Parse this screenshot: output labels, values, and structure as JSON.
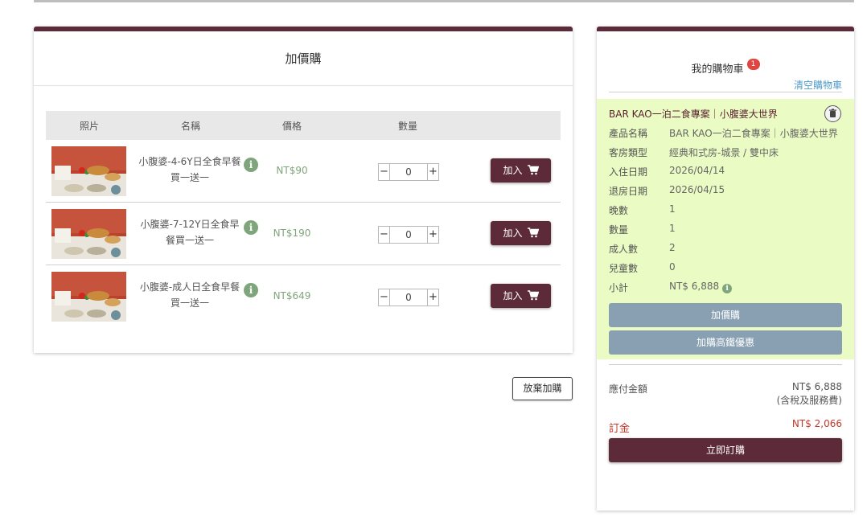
{
  "addon": {
    "title": "加價購",
    "columns": [
      "照片",
      "名稱",
      "價格",
      "數量"
    ],
    "items": [
      {
        "name": "小腹婆-4-6Y日全食早餐買一送一",
        "price": "NT$90",
        "qty": "0",
        "button": "加入"
      },
      {
        "name": "小腹婆-7-12Y日全食早餐買一送一",
        "price": "NT$190",
        "qty": "0",
        "button": "加入"
      },
      {
        "name": "小腹婆-成人日全食早餐買一送一",
        "price": "NT$649",
        "qty": "0",
        "button": "加入"
      }
    ],
    "minus": "−",
    "plus": "+",
    "giveup_label": "放棄加購"
  },
  "cart": {
    "title": "我的購物車",
    "badge": "1",
    "clear_label": "清空購物車",
    "item": {
      "title": "BAR KAO一泊二食專案｜小腹婆大世界",
      "rows": [
        {
          "k": "產品名稱",
          "v": "BAR KAO一泊二食專案｜小腹婆大世界"
        },
        {
          "k": "客房類型",
          "v": "經典和式房-城景 / 雙中床"
        },
        {
          "k": "入住日期",
          "v": "2026/04/14"
        },
        {
          "k": "退房日期",
          "v": "2026/04/15"
        },
        {
          "k": "晚數",
          "v": "1"
        },
        {
          "k": "數量",
          "v": "1"
        },
        {
          "k": "成人數",
          "v": "2"
        },
        {
          "k": "兒童數",
          "v": "0"
        },
        {
          "k": "小計",
          "v": "NT$ 6,888"
        }
      ],
      "addon_button": "加價購",
      "rail_button": "加購高鐵優惠"
    },
    "payable_label": "應付金額",
    "payable_value": "NT$ 6,888",
    "payable_note": "(含稅及服務費)",
    "deposit_label": "訂金",
    "deposit_value": "NT$ 2,066",
    "order_button": "立即訂購"
  },
  "colors": {
    "brand": "#5d2a3a",
    "green": "#7fa57b",
    "link": "#4f9bc7",
    "highlight": "#eafcc3",
    "grey_button": "#88a0b2",
    "deposit": "#c0392b"
  },
  "icons": {
    "info": "info-icon",
    "cart": "cart-icon",
    "trash": "trash-icon"
  }
}
